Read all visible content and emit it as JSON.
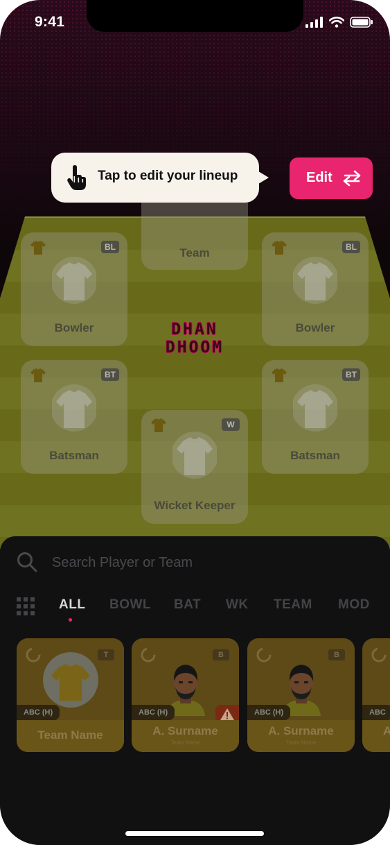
{
  "status_bar": {
    "time": "9:41"
  },
  "tooltip": {
    "text": "Tap to edit your lineup"
  },
  "edit_button": {
    "label": "Edit"
  },
  "logo": {
    "line1": "DHAN",
    "line2": "DHOOM"
  },
  "pitch": {
    "team_card": {
      "label": "Team"
    },
    "bowler_left": {
      "label": "Bowler",
      "badge": "BL"
    },
    "bowler_right": {
      "label": "Bowler",
      "badge": "BL"
    },
    "batsman_left": {
      "label": "Batsman",
      "badge": "BT"
    },
    "batsman_right": {
      "label": "Batsman",
      "badge": "BT"
    },
    "wicket_keeper": {
      "label": "Wicket Keeper",
      "badge": "W"
    }
  },
  "search": {
    "placeholder": "Search Player or Team"
  },
  "filters": {
    "tabs": [
      "ALL",
      "BOWL",
      "BAT",
      "WK",
      "TEAM",
      "MOD"
    ],
    "active": "ALL"
  },
  "player_cards": [
    {
      "tag": "T",
      "team": "ABC (H)",
      "name": "Team Name",
      "sub": ""
    },
    {
      "tag": "B",
      "team": "ABC (H)",
      "name": "A. Surname",
      "sub": "Team Name"
    },
    {
      "tag": "B",
      "team": "ABC (H)",
      "name": "A. Surname",
      "sub": "Team Name"
    },
    {
      "tag": "",
      "team": "ABC",
      "name": "A",
      "sub": ""
    }
  ],
  "colors": {
    "accent": "#e8256e",
    "sheet": "#111112",
    "pitch": "#686a1a"
  }
}
